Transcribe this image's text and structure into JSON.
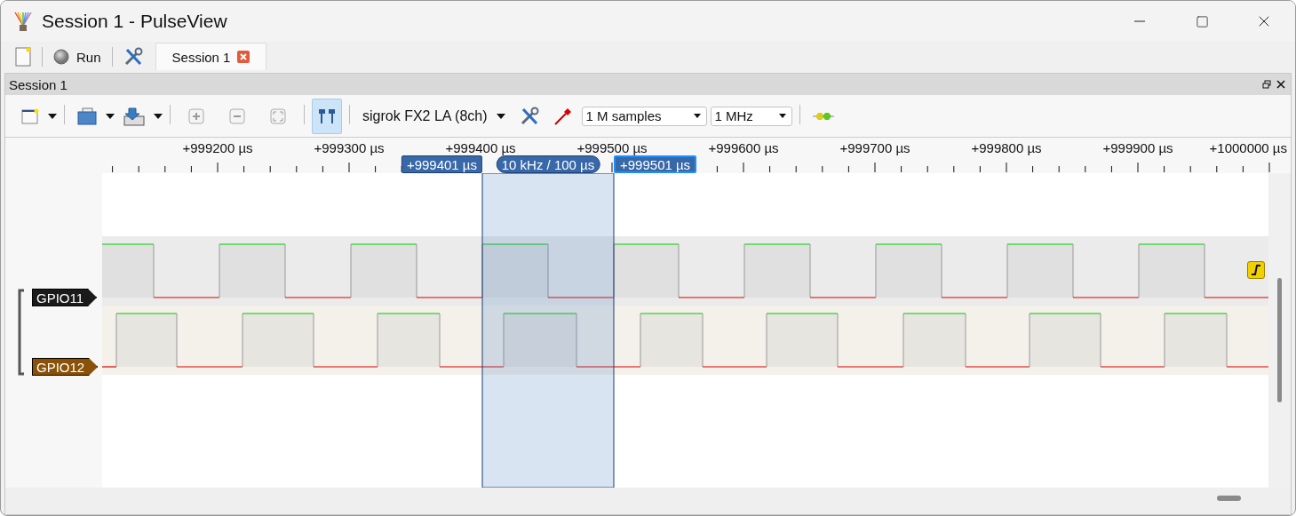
{
  "window": {
    "title": "Session 1 - PulseView"
  },
  "main_toolbar": {
    "run_label": "Run"
  },
  "tabs": [
    {
      "label": "Session 1",
      "selected": true
    }
  ],
  "dock": {
    "title": "Session 1"
  },
  "session_toolbar": {
    "cursors_on": true,
    "device": "sigrok FX2 LA (8ch)",
    "samples": "1 M samples",
    "rate": "1 MHz"
  },
  "ruler": {
    "labels": [
      "+999200 µs",
      "+999300 µs",
      "+999400 µs",
      "+999500 µs",
      "+999600 µs",
      "+999700 µs",
      "+999800 µs",
      "+999900 µs",
      "+1000000 µs"
    ]
  },
  "cursors": [
    {
      "label": "+999401 µs",
      "selected": false
    },
    {
      "label": "+999501 µs",
      "selected": true
    }
  ],
  "cursor_span_label": "10 kHz / 100 µs",
  "channels": [
    {
      "name": "GPIO11",
      "color": "#1a1a1a",
      "trigger": true
    },
    {
      "name": "GPIO12",
      "color": "#8a5208",
      "trigger": false
    }
  ]
}
